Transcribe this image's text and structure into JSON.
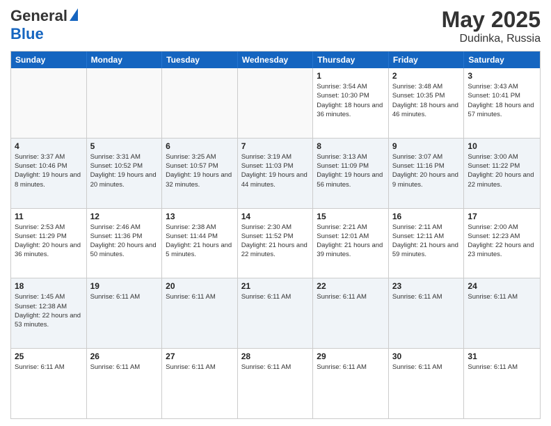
{
  "header": {
    "logo_general": "General",
    "logo_blue": "Blue",
    "month_year": "May 2025",
    "location": "Dudinka, Russia"
  },
  "calendar": {
    "days_of_week": [
      "Sunday",
      "Monday",
      "Tuesday",
      "Wednesday",
      "Thursday",
      "Friday",
      "Saturday"
    ],
    "weeks": [
      [
        {
          "day": "",
          "info": ""
        },
        {
          "day": "",
          "info": ""
        },
        {
          "day": "",
          "info": ""
        },
        {
          "day": "",
          "info": ""
        },
        {
          "day": "1",
          "info": "Sunrise: 3:54 AM\nSunset: 10:30 PM\nDaylight: 18 hours and 36 minutes."
        },
        {
          "day": "2",
          "info": "Sunrise: 3:48 AM\nSunset: 10:35 PM\nDaylight: 18 hours and 46 minutes."
        },
        {
          "day": "3",
          "info": "Sunrise: 3:43 AM\nSunset: 10:41 PM\nDaylight: 18 hours and 57 minutes."
        }
      ],
      [
        {
          "day": "4",
          "info": "Sunrise: 3:37 AM\nSunset: 10:46 PM\nDaylight: 19 hours and 8 minutes."
        },
        {
          "day": "5",
          "info": "Sunrise: 3:31 AM\nSunset: 10:52 PM\nDaylight: 19 hours and 20 minutes."
        },
        {
          "day": "6",
          "info": "Sunrise: 3:25 AM\nSunset: 10:57 PM\nDaylight: 19 hours and 32 minutes."
        },
        {
          "day": "7",
          "info": "Sunrise: 3:19 AM\nSunset: 11:03 PM\nDaylight: 19 hours and 44 minutes."
        },
        {
          "day": "8",
          "info": "Sunrise: 3:13 AM\nSunset: 11:09 PM\nDaylight: 19 hours and 56 minutes."
        },
        {
          "day": "9",
          "info": "Sunrise: 3:07 AM\nSunset: 11:16 PM\nDaylight: 20 hours and 9 minutes."
        },
        {
          "day": "10",
          "info": "Sunrise: 3:00 AM\nSunset: 11:22 PM\nDaylight: 20 hours and 22 minutes."
        }
      ],
      [
        {
          "day": "11",
          "info": "Sunrise: 2:53 AM\nSunset: 11:29 PM\nDaylight: 20 hours and 36 minutes."
        },
        {
          "day": "12",
          "info": "Sunrise: 2:46 AM\nSunset: 11:36 PM\nDaylight: 20 hours and 50 minutes."
        },
        {
          "day": "13",
          "info": "Sunrise: 2:38 AM\nSunset: 11:44 PM\nDaylight: 21 hours and 5 minutes."
        },
        {
          "day": "14",
          "info": "Sunrise: 2:30 AM\nSunset: 11:52 PM\nDaylight: 21 hours and 22 minutes."
        },
        {
          "day": "15",
          "info": "Sunrise: 2:21 AM\nSunset: 12:01 AM\nDaylight: 21 hours and 39 minutes."
        },
        {
          "day": "16",
          "info": "Sunrise: 2:11 AM\nSunset: 12:11 AM\nDaylight: 21 hours and 59 minutes."
        },
        {
          "day": "17",
          "info": "Sunrise: 2:00 AM\nSunset: 12:23 AM\nDaylight: 22 hours and 23 minutes."
        }
      ],
      [
        {
          "day": "18",
          "info": "Sunrise: 1:45 AM\nSunset: 12:38 AM\nDaylight: 22 hours and 53 minutes."
        },
        {
          "day": "19",
          "info": "Sunrise: 6:11 AM"
        },
        {
          "day": "20",
          "info": "Sunrise: 6:11 AM"
        },
        {
          "day": "21",
          "info": "Sunrise: 6:11 AM"
        },
        {
          "day": "22",
          "info": "Sunrise: 6:11 AM"
        },
        {
          "day": "23",
          "info": "Sunrise: 6:11 AM"
        },
        {
          "day": "24",
          "info": "Sunrise: 6:11 AM"
        }
      ],
      [
        {
          "day": "25",
          "info": "Sunrise: 6:11 AM"
        },
        {
          "day": "26",
          "info": "Sunrise: 6:11 AM"
        },
        {
          "day": "27",
          "info": "Sunrise: 6:11 AM"
        },
        {
          "day": "28",
          "info": "Sunrise: 6:11 AM"
        },
        {
          "day": "29",
          "info": "Sunrise: 6:11 AM"
        },
        {
          "day": "30",
          "info": "Sunrise: 6:11 AM"
        },
        {
          "day": "31",
          "info": "Sunrise: 6:11 AM"
        }
      ]
    ]
  }
}
